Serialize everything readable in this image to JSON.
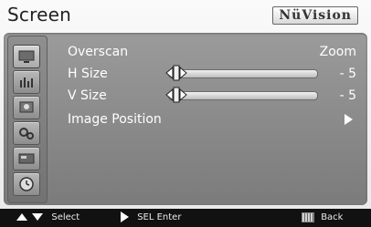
{
  "header": {
    "title": "Screen",
    "brand": "NüVision"
  },
  "sidebar": {
    "items": [
      {
        "icon": "monitor-icon"
      },
      {
        "icon": "equalizer-icon"
      },
      {
        "icon": "picture-adjust-icon"
      },
      {
        "icon": "settings-gears-icon"
      },
      {
        "icon": "input-source-icon"
      },
      {
        "icon": "clock-icon"
      }
    ]
  },
  "menu": {
    "overscan": {
      "label": "Overscan",
      "value": "Zoom"
    },
    "h_size": {
      "label": "H Size",
      "value": "- 5",
      "level": 0.05
    },
    "v_size": {
      "label": "V Size",
      "value": "- 5",
      "level": 0.05
    },
    "image_position": {
      "label": "Image Position"
    }
  },
  "footer": {
    "select": "Select",
    "enter": "SEL Enter",
    "back": "Back"
  },
  "colors": {
    "panel": "#8a8a8a",
    "text": "#ffffff",
    "footer": "#111111"
  }
}
